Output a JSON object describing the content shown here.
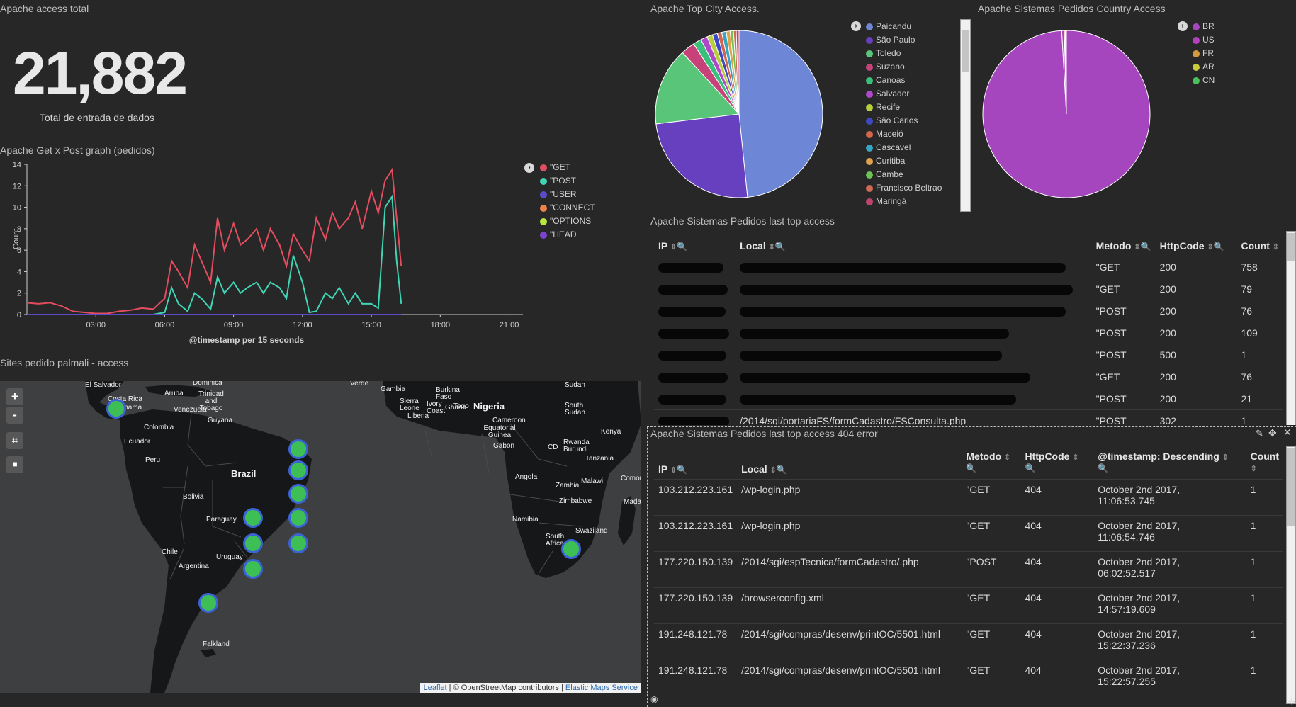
{
  "metric": {
    "title": "Apache access total",
    "value": "21,882",
    "label": "Total de entrada de dados"
  },
  "get_post": {
    "title": "Apache Get x Post graph (pedidos)",
    "ylabel": "Count",
    "xlabel": "@timestamp per 15 seconds",
    "legend_icon": "chevron-right-icon",
    "legend": [
      {
        "name": "\"GET",
        "color": "#e24d5f"
      },
      {
        "name": "\"POST",
        "color": "#3fd5b5"
      },
      {
        "name": "\"USER",
        "color": "#5a4cc9"
      },
      {
        "name": "\"CONNECT",
        "color": "#f17f4a"
      },
      {
        "name": "\"OPTIONS",
        "color": "#b8e83e"
      },
      {
        "name": "\"HEAD",
        "color": "#7a44cf"
      }
    ]
  },
  "chart_data": [
    {
      "type": "line",
      "title": "Apache Get x Post graph (pedidos)",
      "xlabel": "@timestamp per 15 seconds",
      "ylabel": "Count",
      "ylim": [
        0,
        14
      ],
      "yticks": [
        0,
        2,
        4,
        6,
        8,
        10,
        12,
        14
      ],
      "xlim": [
        0,
        21.6
      ],
      "xticks": [
        "03:00",
        "06:00",
        "09:00",
        "12:00",
        "15:00",
        "18:00",
        "21:00"
      ],
      "x": [
        0,
        0.5,
        1,
        1.5,
        2,
        2.5,
        3,
        3.5,
        4,
        4.5,
        5,
        5.5,
        6,
        6.3,
        6.6,
        7,
        7.3,
        7.6,
        8,
        8.3,
        8.6,
        9,
        9.3,
        9.6,
        10,
        10.3,
        10.6,
        11,
        11.3,
        11.6,
        12,
        12.3,
        12.6,
        13,
        13.3,
        13.6,
        14,
        14.3,
        14.6,
        15,
        15.3,
        15.6,
        15.9,
        16.1,
        16.3
      ],
      "series": [
        {
          "name": "\"GET",
          "color": "#e24d5f",
          "values": [
            1.1,
            1.0,
            1.1,
            0.8,
            0.3,
            0.2,
            0.1,
            0.1,
            0.3,
            0.4,
            0.6,
            0.5,
            1.5,
            5.0,
            4.0,
            2.5,
            6.5,
            5.0,
            3.0,
            9.0,
            6.0,
            8.5,
            6.5,
            7.0,
            8.0,
            6.0,
            8.0,
            6.5,
            4.5,
            7.5,
            6.0,
            5.0,
            9.0,
            7.0,
            9.5,
            8.0,
            9.0,
            10.5,
            8.0,
            11.5,
            9.5,
            12.5,
            13.5,
            9.0,
            4.5
          ]
        },
        {
          "name": "\"POST",
          "color": "#3fd5b5",
          "values": [
            0,
            0,
            0,
            0,
            0,
            0,
            0,
            0,
            0,
            0,
            0,
            0,
            0.2,
            2.5,
            1.0,
            0.3,
            2.0,
            1.5,
            0.5,
            3.5,
            2.0,
            3.0,
            2.0,
            2.5,
            3.0,
            2.0,
            3.0,
            2.5,
            1.5,
            5.5,
            3.0,
            0.2,
            0.3,
            2.0,
            1.5,
            2.5,
            1.0,
            2.0,
            1.0,
            1.0,
            0.6,
            10.0,
            11.0,
            5.0,
            1.0
          ]
        },
        {
          "name": "\"USER",
          "color": "#5a4cc9",
          "values": [
            0,
            0,
            0,
            0,
            0,
            0,
            0,
            0,
            0,
            0,
            0,
            0,
            0,
            0,
            0,
            0,
            0,
            0,
            0,
            0,
            0,
            0,
            0,
            0,
            0,
            0,
            0,
            0,
            0,
            0,
            0,
            0,
            0,
            0,
            0,
            0,
            0,
            0,
            0,
            0,
            0,
            0,
            0,
            0,
            0
          ]
        }
      ]
    },
    {
      "type": "pie",
      "title": "Apache Top City Access.",
      "categories": [
        "Paicandu",
        "São Paulo",
        "Toledo",
        "Suzano",
        "Canoas",
        "Salvador",
        "Recife",
        "São Carlos",
        "Maceió",
        "Cascavel",
        "Curitiba",
        "Cambe",
        "Francisco Beltrao",
        "Maringá"
      ],
      "values": [
        45,
        23,
        14,
        2.5,
        1.5,
        1.2,
        1.0,
        0.9,
        0.8,
        0.8,
        0.7,
        0.6,
        0.5,
        0.5
      ],
      "colors": [
        "#6e86d6",
        "#6740c0",
        "#58c579",
        "#c8427a",
        "#39c07a",
        "#b049c9",
        "#b7cf3b",
        "#3f48c3",
        "#d3654a",
        "#35a7c2",
        "#e0a24d",
        "#6dc452",
        "#d06a55",
        "#c0426e"
      ]
    },
    {
      "type": "pie",
      "title": "Apache Sistemas Pedidos Country Access",
      "categories": [
        "BR",
        "US",
        "FR",
        "AR",
        "CN"
      ],
      "values": [
        99.1,
        0.5,
        0.2,
        0.1,
        0.1
      ],
      "colors": [
        "#a646bf",
        "#b43fbf",
        "#d69a3e",
        "#c9c93c",
        "#49c05a"
      ]
    }
  ],
  "top_city": {
    "title": "Apache Top City Access.",
    "legend_icon": "chevron-right-icon",
    "legend": [
      {
        "name": "Paicandu",
        "color": "#6e86d6"
      },
      {
        "name": "São Paulo",
        "color": "#6740c0"
      },
      {
        "name": "Toledo",
        "color": "#58c579"
      },
      {
        "name": "Suzano",
        "color": "#c8427a"
      },
      {
        "name": "Canoas",
        "color": "#39c07a"
      },
      {
        "name": "Salvador",
        "color": "#b049c9"
      },
      {
        "name": "Recife",
        "color": "#b7cf3b"
      },
      {
        "name": "São Carlos",
        "color": "#3f48c3"
      },
      {
        "name": "Maceió",
        "color": "#d3654a"
      },
      {
        "name": "Cascavel",
        "color": "#35a7c2"
      },
      {
        "name": "Curitiba",
        "color": "#e0a24d"
      },
      {
        "name": "Cambe",
        "color": "#6dc452"
      },
      {
        "name": "Francisco Beltrao",
        "color": "#d06a55"
      },
      {
        "name": "Maringá",
        "color": "#c0426e"
      }
    ]
  },
  "country": {
    "title": "Apache Sistemas Pedidos Country Access",
    "legend_icon": "chevron-right-icon",
    "legend": [
      {
        "name": "BR",
        "color": "#a646bf"
      },
      {
        "name": "US",
        "color": "#b43fbf"
      },
      {
        "name": "FR",
        "color": "#d69a3e"
      },
      {
        "name": "AR",
        "color": "#c9c93c"
      },
      {
        "name": "CN",
        "color": "#49c05a"
      }
    ]
  },
  "last_access": {
    "title": "Apache Sistemas Pedidos last top access",
    "columns": [
      "IP",
      "Local",
      "Metodo",
      "HttpCode",
      "Count"
    ],
    "rows": [
      {
        "metodo": "\"GET",
        "code": "200",
        "count": "758"
      },
      {
        "metodo": "\"GET",
        "code": "200",
        "count": "79"
      },
      {
        "metodo": "\"POST",
        "code": "200",
        "count": "76"
      },
      {
        "metodo": "\"POST",
        "code": "200",
        "count": "109"
      },
      {
        "metodo": "\"POST",
        "code": "500",
        "count": "1"
      },
      {
        "metodo": "\"GET",
        "code": "200",
        "count": "76"
      },
      {
        "metodo": "\"POST",
        "code": "200",
        "count": "21"
      },
      {
        "metodo": "\"POST",
        "code": "302",
        "count": "1",
        "local": "/2014/sgi/portariaFS/formCadastro/FSConsulta.php"
      }
    ]
  },
  "errors_404": {
    "title": "Apache Sistemas Pedidos last top access 404 error",
    "columns": [
      "IP",
      "Local",
      "Metodo",
      "HttpCode",
      "@timestamp: Descending",
      "Count"
    ],
    "rows": [
      {
        "ip": "103.212.223.161",
        "local": "/wp-login.php",
        "metodo": "\"GET",
        "code": "404",
        "ts1": "October 2nd 2017,",
        "ts2": "11:06:53.745",
        "count": "1"
      },
      {
        "ip": "103.212.223.161",
        "local": "/wp-login.php",
        "metodo": "\"GET",
        "code": "404",
        "ts1": "October 2nd 2017,",
        "ts2": "11:06:54.746",
        "count": "1"
      },
      {
        "ip": "177.220.150.139",
        "local": "/2014/sgi/espTecnica/formCadastro/.php",
        "metodo": "\"POST",
        "code": "404",
        "ts1": "October 2nd 2017,",
        "ts2": "06:02:52.517",
        "count": "1"
      },
      {
        "ip": "177.220.150.139",
        "local": "/browserconfig.xml",
        "metodo": "\"GET",
        "code": "404",
        "ts1": "October 2nd 2017,",
        "ts2": "14:57:19.609",
        "count": "1"
      },
      {
        "ip": "191.248.121.78",
        "local": "/2014/sgi/compras/desenv/printOC/5501.html",
        "metodo": "\"GET",
        "code": "404",
        "ts1": "October 2nd 2017,",
        "ts2": "15:22:37.236",
        "count": "1"
      },
      {
        "ip": "191.248.121.78",
        "local": "/2014/sgi/compras/desenv/printOC/5501.html",
        "metodo": "\"GET",
        "code": "404",
        "ts1": "October 2nd 2017,",
        "ts2": "15:22:57.255",
        "count": "1"
      }
    ]
  },
  "map": {
    "title": "Sites pedido palmali - access",
    "zoom_in": "+",
    "zoom_out": "-",
    "attribution_leaflet": "Leaflet",
    "attribution_mid": "| © OpenStreetMap contributors |",
    "attribution_ems": "Elastic Maps Service",
    "labels": {
      "brazil": "Brazil",
      "nigeria": "Nigeria",
      "salvador": "El Salvador",
      "costa": "Costa Rica",
      "panama": "Panama",
      "aruba": "Aruba",
      "dominica": "Dominica",
      "trinidad": "Trinidad and Tobago",
      "venezuela": "Venezuela",
      "guyana": "Guyana",
      "colombia": "Colombia",
      "ecuador": "Ecuador",
      "peru": "Peru",
      "bolivia": "Bolivia",
      "paraguay": "Paraguay",
      "chile": "Chile",
      "uruguay": "Uruguay",
      "argentina": "Argentina",
      "falkland": "Falkland",
      "verde": "Verde",
      "gambia": "Gambia",
      "sierra": "Sierra Leone",
      "liberia": "Liberia",
      "burkina": "Burkina Faso",
      "ivory": "Ivory Coast",
      "ghana": "Ghana",
      "togo": "Togo",
      "cameroon": "Cameroon",
      "equatorial": "Equatorial Guinea",
      "gabon": "Gabon",
      "cd": "CD",
      "sudan": "Sudan",
      "south_sudan": "South Sudan",
      "kenya": "Kenya",
      "rwanda": "Rwanda Burundi",
      "tanzania": "Tanzania",
      "angola": "Angola",
      "zambia": "Zambia",
      "malawi": "Malawi",
      "zimbabwe": "Zimbabwe",
      "namibia": "Namibia",
      "south_africa": "South Africa",
      "swaziland": "Swaziland",
      "comoros": "Comoro",
      "madagascar": "Mada"
    }
  }
}
